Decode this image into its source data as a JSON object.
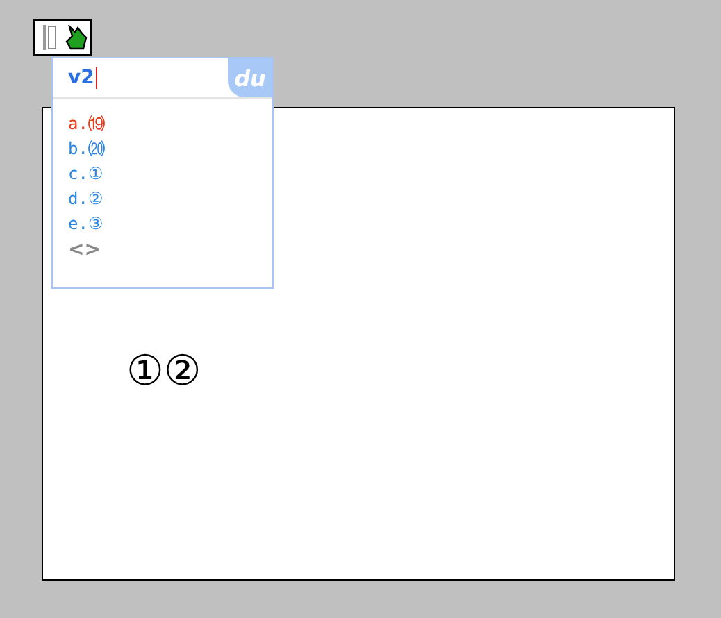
{
  "document": {
    "text": "①②"
  },
  "ime": {
    "composition": "v2",
    "logo": "du",
    "candidates": [
      {
        "label": "a.",
        "text": "⒆",
        "selected": true
      },
      {
        "label": "b.",
        "text": "⒇",
        "selected": false
      },
      {
        "label": "c.",
        "text": "①",
        "selected": false
      },
      {
        "label": "d.",
        "text": "②",
        "selected": false
      },
      {
        "label": "e.",
        "text": "③",
        "selected": false
      }
    ],
    "paging": "<>"
  }
}
